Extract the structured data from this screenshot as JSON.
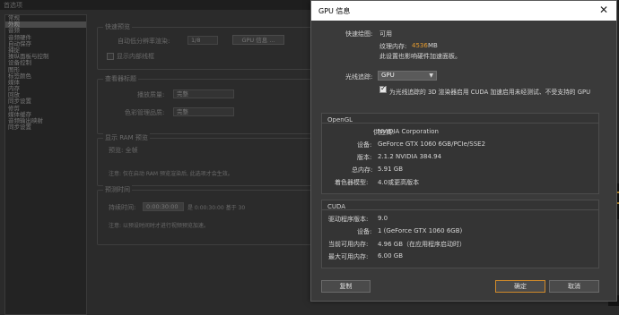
{
  "background": {
    "window_title": "首选项",
    "sidebar_items": [
      "常规",
      "外观",
      "音频",
      "音频硬件",
      "自动保存",
      "捕捉",
      "操纵面板与控制",
      "设备控制",
      "图形",
      "标签颜色",
      "媒体",
      "内存",
      "回放",
      "同步设置",
      "修剪",
      "媒体缓存",
      "音频输出映射",
      "同步设置"
    ],
    "selected_index": 1,
    "groups": {
      "quick_preview": {
        "title": "快速预览",
        "row1_label": "自动低分辨率渲染:",
        "row1_value": "1/8",
        "row1_button": "GPU 信息 ...",
        "row2_label": "显示内部线框"
      },
      "color": {
        "title": "查看器标题",
        "row1_label": "播放质量:",
        "row1_value": "完整",
        "row2_label": "色彩管理品质:",
        "row2_value": "完整"
      },
      "ram_preview": {
        "title": "显示 RAM 预览",
        "row1_label": "预览: 全帧",
        "note": "注意: 仅在启动 RAM 预览渲染后, 此选项才会生效。"
      },
      "timecode": {
        "title": "预测时间",
        "row1_label": "持续时间:",
        "row1_value": "0:00:30:00",
        "row1_extra": "是 0:00:30:00 基于 30",
        "note": "注意: 以预设时间时才进行视频预览加速。"
      }
    },
    "sidebar_colors": {
      "accent": "#c7952e"
    }
  },
  "dialog": {
    "title": "GPU 信息",
    "close_icon": "close-icon",
    "render_label": "快速绘图:",
    "render_value": "可用",
    "texture_label": "纹理内存:",
    "texture_value": "4536",
    "texture_unit": "MB",
    "texture_note": "此设置也影响硬件加速面板。",
    "raytrace_label": "光线追踪:",
    "raytrace_value": "GPU",
    "checkbox_label": "为光线追踪的 3D 渲染器启用 CUDA 加速启用未经测试、不受支持的 GPU",
    "opengl": {
      "title": "OpenGL",
      "rows": [
        {
          "label": "供应商:",
          "value": "NVIDIA Corporation"
        },
        {
          "label": "设备:",
          "value": "GeForce GTX 1060 6GB/PCIe/SSE2"
        },
        {
          "label": "版本:",
          "value": "2.1.2 NVIDIA 384.94"
        },
        {
          "label": "总内存:",
          "value": "5.91 GB"
        },
        {
          "label": "着色器模型:",
          "value": "4.0或更高版本"
        }
      ]
    },
    "cuda": {
      "title": "CUDA",
      "rows": [
        {
          "label": "驱动程序版本:",
          "value": "9.0"
        },
        {
          "label": "设备:",
          "value": "1 (GeForce GTX 1060 6GB)"
        },
        {
          "label": "当前可用内存:",
          "value": "4.96 GB（在应用程序启动时）"
        },
        {
          "label": "最大可用内存:",
          "value": "6.00 GB"
        }
      ]
    },
    "buttons": {
      "copy": "复制",
      "ok": "确定",
      "cancel": "取消"
    },
    "colors": {
      "highlight": "#e69c2f",
      "panel": "#3a3a3a"
    }
  }
}
